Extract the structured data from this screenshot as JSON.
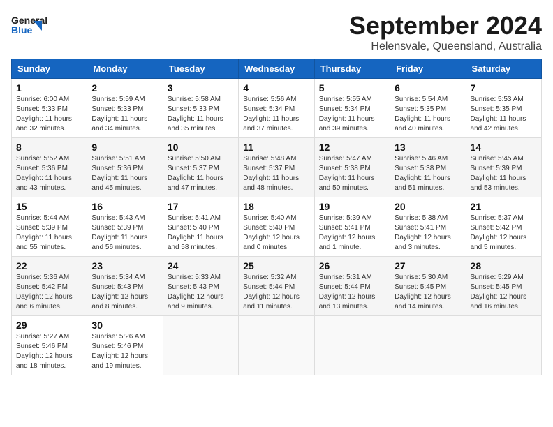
{
  "header": {
    "logo_line1": "General",
    "logo_line2": "Blue",
    "month": "September 2024",
    "location": "Helensvale, Queensland, Australia"
  },
  "weekdays": [
    "Sunday",
    "Monday",
    "Tuesday",
    "Wednesday",
    "Thursday",
    "Friday",
    "Saturday"
  ],
  "weeks": [
    [
      {
        "day": "1",
        "info": "Sunrise: 6:00 AM\nSunset: 5:33 PM\nDaylight: 11 hours\nand 32 minutes."
      },
      {
        "day": "2",
        "info": "Sunrise: 5:59 AM\nSunset: 5:33 PM\nDaylight: 11 hours\nand 34 minutes."
      },
      {
        "day": "3",
        "info": "Sunrise: 5:58 AM\nSunset: 5:33 PM\nDaylight: 11 hours\nand 35 minutes."
      },
      {
        "day": "4",
        "info": "Sunrise: 5:56 AM\nSunset: 5:34 PM\nDaylight: 11 hours\nand 37 minutes."
      },
      {
        "day": "5",
        "info": "Sunrise: 5:55 AM\nSunset: 5:34 PM\nDaylight: 11 hours\nand 39 minutes."
      },
      {
        "day": "6",
        "info": "Sunrise: 5:54 AM\nSunset: 5:35 PM\nDaylight: 11 hours\nand 40 minutes."
      },
      {
        "day": "7",
        "info": "Sunrise: 5:53 AM\nSunset: 5:35 PM\nDaylight: 11 hours\nand 42 minutes."
      }
    ],
    [
      {
        "day": "8",
        "info": "Sunrise: 5:52 AM\nSunset: 5:36 PM\nDaylight: 11 hours\nand 43 minutes."
      },
      {
        "day": "9",
        "info": "Sunrise: 5:51 AM\nSunset: 5:36 PM\nDaylight: 11 hours\nand 45 minutes."
      },
      {
        "day": "10",
        "info": "Sunrise: 5:50 AM\nSunset: 5:37 PM\nDaylight: 11 hours\nand 47 minutes."
      },
      {
        "day": "11",
        "info": "Sunrise: 5:48 AM\nSunset: 5:37 PM\nDaylight: 11 hours\nand 48 minutes."
      },
      {
        "day": "12",
        "info": "Sunrise: 5:47 AM\nSunset: 5:38 PM\nDaylight: 11 hours\nand 50 minutes."
      },
      {
        "day": "13",
        "info": "Sunrise: 5:46 AM\nSunset: 5:38 PM\nDaylight: 11 hours\nand 51 minutes."
      },
      {
        "day": "14",
        "info": "Sunrise: 5:45 AM\nSunset: 5:39 PM\nDaylight: 11 hours\nand 53 minutes."
      }
    ],
    [
      {
        "day": "15",
        "info": "Sunrise: 5:44 AM\nSunset: 5:39 PM\nDaylight: 11 hours\nand 55 minutes."
      },
      {
        "day": "16",
        "info": "Sunrise: 5:43 AM\nSunset: 5:39 PM\nDaylight: 11 hours\nand 56 minutes."
      },
      {
        "day": "17",
        "info": "Sunrise: 5:41 AM\nSunset: 5:40 PM\nDaylight: 11 hours\nand 58 minutes."
      },
      {
        "day": "18",
        "info": "Sunrise: 5:40 AM\nSunset: 5:40 PM\nDaylight: 12 hours\nand 0 minutes."
      },
      {
        "day": "19",
        "info": "Sunrise: 5:39 AM\nSunset: 5:41 PM\nDaylight: 12 hours\nand 1 minute."
      },
      {
        "day": "20",
        "info": "Sunrise: 5:38 AM\nSunset: 5:41 PM\nDaylight: 12 hours\nand 3 minutes."
      },
      {
        "day": "21",
        "info": "Sunrise: 5:37 AM\nSunset: 5:42 PM\nDaylight: 12 hours\nand 5 minutes."
      }
    ],
    [
      {
        "day": "22",
        "info": "Sunrise: 5:36 AM\nSunset: 5:42 PM\nDaylight: 12 hours\nand 6 minutes."
      },
      {
        "day": "23",
        "info": "Sunrise: 5:34 AM\nSunset: 5:43 PM\nDaylight: 12 hours\nand 8 minutes."
      },
      {
        "day": "24",
        "info": "Sunrise: 5:33 AM\nSunset: 5:43 PM\nDaylight: 12 hours\nand 9 minutes."
      },
      {
        "day": "25",
        "info": "Sunrise: 5:32 AM\nSunset: 5:44 PM\nDaylight: 12 hours\nand 11 minutes."
      },
      {
        "day": "26",
        "info": "Sunrise: 5:31 AM\nSunset: 5:44 PM\nDaylight: 12 hours\nand 13 minutes."
      },
      {
        "day": "27",
        "info": "Sunrise: 5:30 AM\nSunset: 5:45 PM\nDaylight: 12 hours\nand 14 minutes."
      },
      {
        "day": "28",
        "info": "Sunrise: 5:29 AM\nSunset: 5:45 PM\nDaylight: 12 hours\nand 16 minutes."
      }
    ],
    [
      {
        "day": "29",
        "info": "Sunrise: 5:27 AM\nSunset: 5:46 PM\nDaylight: 12 hours\nand 18 minutes."
      },
      {
        "day": "30",
        "info": "Sunrise: 5:26 AM\nSunset: 5:46 PM\nDaylight: 12 hours\nand 19 minutes."
      },
      {
        "day": "",
        "info": ""
      },
      {
        "day": "",
        "info": ""
      },
      {
        "day": "",
        "info": ""
      },
      {
        "day": "",
        "info": ""
      },
      {
        "day": "",
        "info": ""
      }
    ]
  ]
}
